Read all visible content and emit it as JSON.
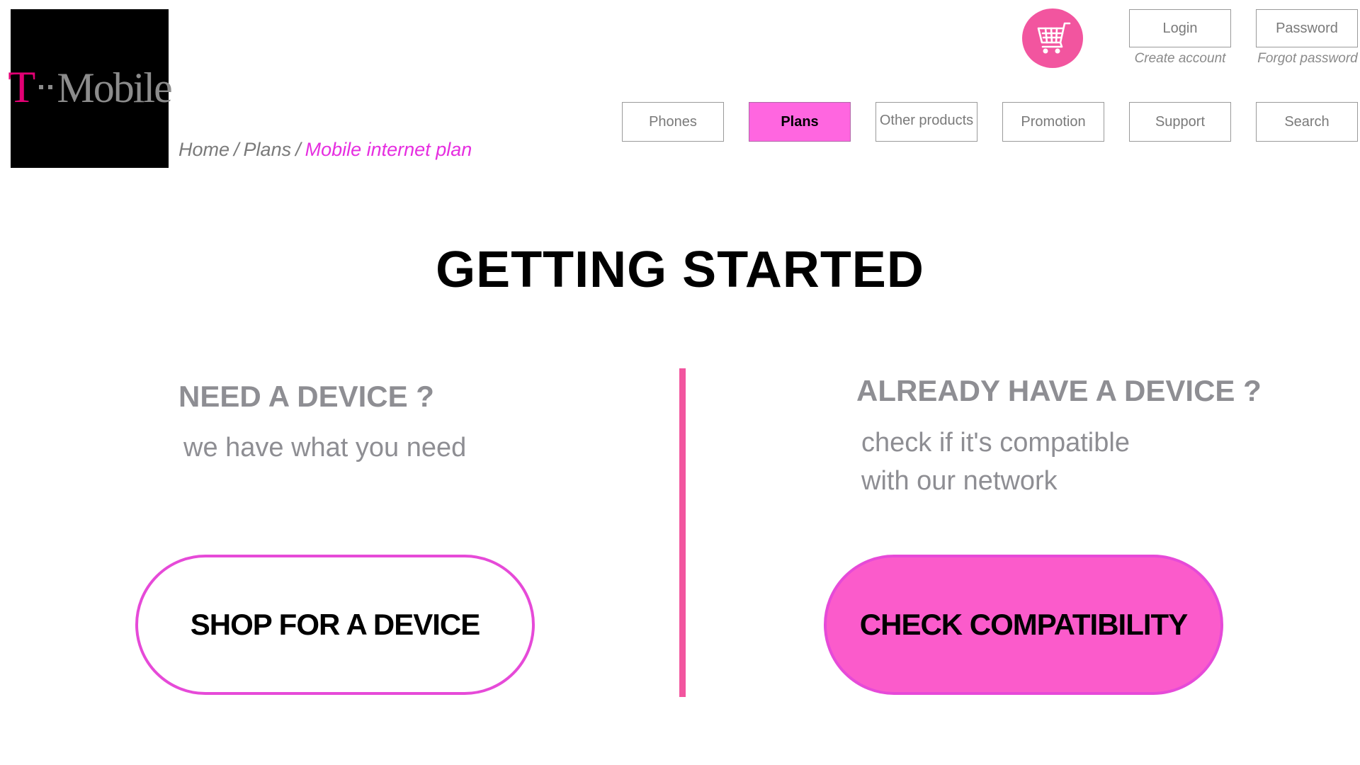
{
  "logo": {
    "t": "T",
    "word": "Mobile",
    "brand_color": "#e20074"
  },
  "breadcrumb": {
    "items": [
      "Home",
      "Plans"
    ],
    "separator": "/",
    "current": "Mobile internet plan",
    "current_color": "#e62ee0"
  },
  "cart": {
    "icon": "shopping-cart-icon",
    "color": "#f2559f"
  },
  "account": {
    "login_label": "Login",
    "password_label": "Password",
    "create_account": "Create account",
    "forgot_password": "Forgot password"
  },
  "nav": {
    "items": [
      {
        "label": "Phones",
        "active": false
      },
      {
        "label": "Plans",
        "active": true
      },
      {
        "label": "Other products",
        "active": false
      },
      {
        "label": "Promotion",
        "active": false
      },
      {
        "label": "Support",
        "active": false
      },
      {
        "label": "Search",
        "active": false
      }
    ],
    "active_color": "#ff66e0"
  },
  "main": {
    "title": "GETTING STARTED",
    "left": {
      "heading": "NEED A DEVICE ?",
      "subtext": "we have what you need",
      "button": "SHOP FOR A DEVICE"
    },
    "right": {
      "heading": "ALREADY HAVE A DEVICE ?",
      "subtext_line1": "check if it's compatible",
      "subtext_line2": "with our network",
      "button": "CHECK COMPATIBILITY"
    },
    "accent_color": "#f2559f"
  }
}
